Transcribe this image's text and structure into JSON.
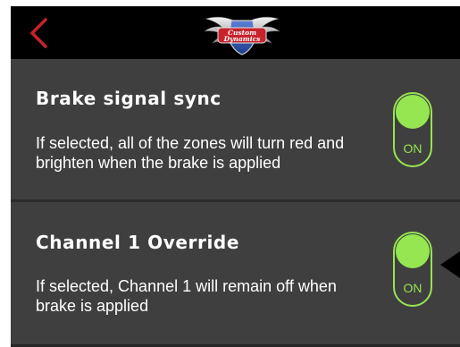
{
  "header": {
    "back_icon": "chevron-left-icon",
    "logo": {
      "line1": "Custom",
      "line2": "Dynamics"
    }
  },
  "settings": [
    {
      "title": "Brake signal sync",
      "description": "If selected, all of the zones will turn red and brighten when the brake is applied",
      "toggle_state": "ON"
    },
    {
      "title": "Channel 1 Override",
      "description": "If selected, Channel 1 will remain off when brake is applied",
      "toggle_state": "ON"
    }
  ],
  "colors": {
    "accent_green": "#95e651",
    "back_red": "#c8232c",
    "panel_bg": "#3f3f3f",
    "header_bg": "#000000"
  }
}
